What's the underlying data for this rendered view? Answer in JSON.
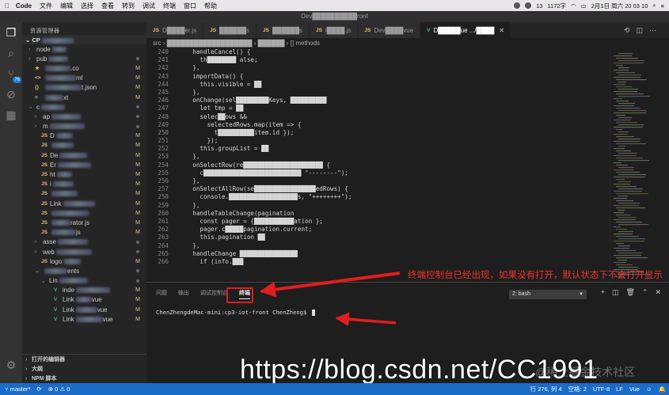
{
  "menubar": {
    "app": "Code",
    "items": [
      "文件",
      "编辑",
      "选择",
      "查看",
      "转到",
      "调试",
      "终端",
      "窗口",
      "帮助"
    ],
    "battery_count": "13",
    "network": "1172字",
    "datetime": "2月1日 周六  20 03 10"
  },
  "window": {
    "title": "Dev██████████ront"
  },
  "sidebar": {
    "title": "资源管理器",
    "root": "CP",
    "rows": [
      {
        "indent": 8,
        "tw": "›",
        "icon": "",
        "label": "node",
        "cls": "",
        "status": "",
        "dot": false
      },
      {
        "indent": 8,
        "tw": "›",
        "icon": "",
        "label": "pub",
        "cls": "",
        "status": "",
        "dot": true
      },
      {
        "indent": 8,
        "tw": "",
        "icon": "★",
        "label": "",
        "cls": "star",
        "after": ".co",
        "status": "M",
        "dot": false
      },
      {
        "indent": 8,
        "tw": "",
        "icon": "<>",
        "label": "",
        "cls": "js",
        "after": "ml",
        "status": "M",
        "dot": false
      },
      {
        "indent": 8,
        "tw": "",
        "icon": "{}",
        "label": "",
        "cls": "json",
        "after": "t.json",
        "status": "M",
        "dot": false
      },
      {
        "indent": 8,
        "tw": "",
        "icon": "≡",
        "label": "",
        "cls": "",
        "after": "xt",
        "status": "M",
        "dot": false
      },
      {
        "indent": 8,
        "tw": "⌄",
        "icon": "",
        "label": "c",
        "cls": "",
        "status": "",
        "dot": true
      },
      {
        "indent": 16,
        "tw": "›",
        "icon": "",
        "label": "ap",
        "cls": "",
        "status": "",
        "dot": true
      },
      {
        "indent": 16,
        "tw": "›",
        "icon": "",
        "label": "m",
        "cls": "",
        "status": "",
        "dot": true
      },
      {
        "indent": 16,
        "tw": "",
        "icon": "JS",
        "label": "D",
        "cls": "js",
        "status": "M",
        "dot": false
      },
      {
        "indent": 16,
        "tw": "",
        "icon": "JS",
        "label": "",
        "cls": "js",
        "status": "M",
        "dot": false
      },
      {
        "indent": 16,
        "tw": "",
        "icon": "JS",
        "label": "De",
        "cls": "js",
        "status": "M",
        "dot": false
      },
      {
        "indent": 16,
        "tw": "",
        "icon": "JS",
        "label": "Er",
        "cls": "js",
        "status": "M",
        "dot": false
      },
      {
        "indent": 16,
        "tw": "",
        "icon": "JS",
        "label": "ht",
        "cls": "js",
        "status": "M",
        "dot": false
      },
      {
        "indent": 16,
        "tw": "",
        "icon": "JS",
        "label": "i",
        "cls": "js",
        "status": "M",
        "dot": false
      },
      {
        "indent": 16,
        "tw": "",
        "icon": "JS",
        "label": "",
        "cls": "js",
        "status": "M",
        "dot": false
      },
      {
        "indent": 16,
        "tw": "",
        "icon": "JS",
        "label": "Link",
        "cls": "js",
        "status": "M",
        "dot": false
      },
      {
        "indent": 16,
        "tw": "",
        "icon": "JS",
        "label": "",
        "cls": "js",
        "status": "M",
        "dot": false
      },
      {
        "indent": 16,
        "tw": "",
        "icon": "JS",
        "label": "",
        "cls": "js",
        "after": "rator.js",
        "status": "M",
        "dot": false
      },
      {
        "indent": 16,
        "tw": "",
        "icon": "JS",
        "label": "",
        "cls": "js",
        "after": "js",
        "status": "M",
        "dot": false
      },
      {
        "indent": 16,
        "tw": "›",
        "icon": "",
        "label": "asse",
        "cls": "",
        "status": "",
        "dot": true
      },
      {
        "indent": 16,
        "tw": "›",
        "icon": "",
        "label": "web",
        "cls": "",
        "status": "",
        "dot": true
      },
      {
        "indent": 16,
        "tw": "",
        "icon": "JS",
        "label": "logo",
        "cls": "js",
        "status": "M",
        "dot": false
      },
      {
        "indent": 16,
        "tw": "⌄",
        "icon": "",
        "label": "",
        "cls": "",
        "after": "ents",
        "status": "",
        "dot": true
      },
      {
        "indent": 24,
        "tw": "⌄",
        "icon": "",
        "label": "Lin",
        "cls": "",
        "status": "",
        "dot": true
      },
      {
        "indent": 32,
        "tw": "",
        "icon": "V",
        "label": "inde",
        "cls": "vue",
        "status": "M",
        "dot": false
      },
      {
        "indent": 32,
        "tw": "",
        "icon": "V",
        "label": "Link",
        "cls": "vue",
        "after": "vue",
        "status": "M",
        "dot": false
      },
      {
        "indent": 32,
        "tw": "",
        "icon": "V",
        "label": "Link",
        "cls": "vue",
        "after": "vue",
        "status": "M",
        "dot": false
      },
      {
        "indent": 32,
        "tw": "",
        "icon": "V",
        "label": "Link",
        "cls": "vue",
        "after": "vue",
        "status": "M",
        "dot": false
      }
    ],
    "bottom_sections": [
      "打开的编辑器",
      "大纲",
      "NPM 脚本"
    ]
  },
  "tabs": [
    {
      "icon": "JS",
      "label": "D████er.js",
      "active": false
    },
    {
      "icon": "JS",
      "label": "██████s",
      "active": false
    },
    {
      "icon": "JS",
      "label": "██████s",
      "active": false
    },
    {
      "icon": "JS",
      "label": "i████.js",
      "active": false
    },
    {
      "icon": "JS",
      "label": "Dev████vue",
      "active": false
    },
    {
      "icon": "V",
      "label": "D█████ue .../████",
      "active": true
    }
  ],
  "breadcrumb": "src › ███████████████████ › ██████ › [] methods",
  "code": [
    {
      "n": "240",
      "t": "    handleCancel() {"
    },
    {
      "n": "241",
      "t": "      th████████ alse;"
    },
    {
      "n": "242",
      "t": "    },"
    },
    {
      "n": "243",
      "t": "    importData() {"
    },
    {
      "n": "244",
      "t": "      this.visible = ██"
    },
    {
      "n": "245",
      "t": "    },"
    },
    {
      "n": "246",
      "t": "    onChange(sel█████████Keys, ██████████"
    },
    {
      "n": "247",
      "t": "      let tmp = ██"
    },
    {
      "n": "248",
      "t": "      selec██ows &&"
    },
    {
      "n": "249",
      "t": "        selectedRows.map(item => {"
    },
    {
      "n": "250",
      "t": "          t██████████item.id });"
    },
    {
      "n": "251",
      "t": "        });"
    },
    {
      "n": "252",
      "t": "      this.groupList = ██"
    },
    {
      "n": "253",
      "t": "    },"
    },
    {
      "n": "254",
      "t": "    onSelectRow(re██████████████████████ {"
    },
    {
      "n": "255",
      "t": "      c███████████████████████████ \"--------\");"
    },
    {
      "n": "256",
      "t": "    },"
    },
    {
      "n": "257",
      "t": "    onSelectAllRow(se█████████████████edRows) {"
    },
    {
      "n": "258",
      "t": "      console.███████████████████s, \"++++++++\");"
    },
    {
      "n": "259",
      "t": "    },"
    },
    {
      "n": "260",
      "t": "    handleTableChange(pagination"
    },
    {
      "n": "261",
      "t": "      const pager = {███████████ation };"
    },
    {
      "n": "262",
      "t": "      pager.c█████pagination.current;"
    },
    {
      "n": "263",
      "t": "      this.pagination ██"
    },
    {
      "n": "264",
      "t": "    },"
    },
    {
      "n": "265",
      "t": "    handleChange ████████████████"
    },
    {
      "n": "266",
      "t": "      if (info.███"
    }
  ],
  "panel": {
    "tabs": [
      "问题",
      "输出",
      "调试控制台",
      "终端"
    ],
    "active_tab": "终端",
    "terminal_select": "2: bash",
    "prompt": "ChenZhengdeMac-mini:cp3-iot-front ChenZheng$ "
  },
  "annotation": "终端控制台已经出现，如果没有打开，默认状态下不会打开显示",
  "watermark": "https://blog.csdn.net/CC1991",
  "watermark_overlay": "@稀土掘金技术社区",
  "statusbar": {
    "branch": "master*",
    "errors": "0",
    "warnings": "0",
    "position": "行 276, 列 4",
    "spaces": "空格: 2",
    "encoding": "UTF-8",
    "eol": "LF",
    "language": "Vue"
  },
  "colors": {
    "statusbar": "#1a6cc8",
    "annotation": "#f0322a",
    "editor_bg": "#1e1e1e"
  }
}
